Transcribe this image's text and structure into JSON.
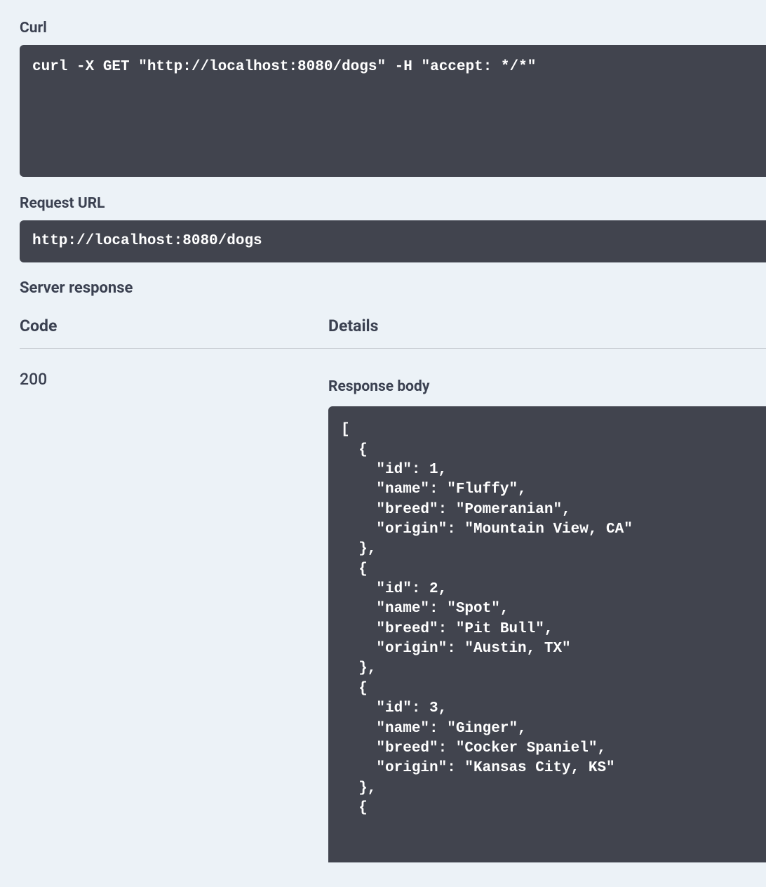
{
  "sections": {
    "curl": {
      "heading": "Curl",
      "command": "curl -X GET \"http://localhost:8080/dogs\" -H \"accept: */*\""
    },
    "request_url": {
      "heading": "Request URL",
      "url": "http://localhost:8080/dogs"
    },
    "server_response": {
      "heading": "Server response",
      "columns": {
        "code": "Code",
        "details": "Details"
      },
      "status_code": "200",
      "response_body": {
        "label": "Response body",
        "text": "[\n  {\n    \"id\": 1,\n    \"name\": \"Fluffy\",\n    \"breed\": \"Pomeranian\",\n    \"origin\": \"Mountain View, CA\"\n  },\n  {\n    \"id\": 2,\n    \"name\": \"Spot\",\n    \"breed\": \"Pit Bull\",\n    \"origin\": \"Austin, TX\"\n  },\n  {\n    \"id\": 3,\n    \"name\": \"Ginger\",\n    \"breed\": \"Cocker Spaniel\",\n    \"origin\": \"Kansas City, KS\"\n  },\n  {"
      }
    }
  }
}
